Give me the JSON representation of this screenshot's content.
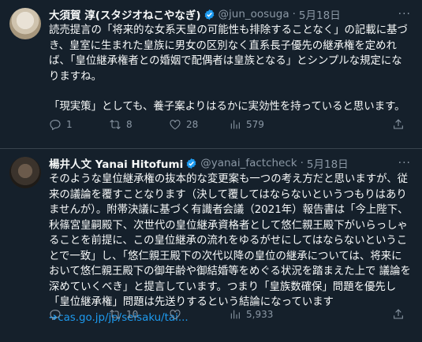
{
  "tweets": [
    {
      "name": "大須賀 淳(スタジオねこやなぎ)",
      "handle": "@jun_oosuga",
      "dot": "·",
      "date": "5月18日",
      "paragraphs": [
        "読売提言の「将来的な女系天皇の可能性も排除することなく」の記載に基づき、皇室に生まれた皇族に男女の区別なく直系長子優先の継承権を定めれば、「皇位継承権者との婚姻で配偶者は皇族となる」とシンプルな規定になりますね。",
        "「現実策」としても、養子案よりはるかに実効性を持っていると思います。"
      ],
      "replies": "1",
      "retweets": "8",
      "likes": "28",
      "views": "579"
    },
    {
      "name": "楊井人文 Yanai Hitofumi",
      "handle": "@yanai_factcheck",
      "dot": "·",
      "date": "5月18日",
      "text": "そのような皇位継承権の抜本的な変更案も一つの考え方だと思いますが、従来の議論を覆すことなります（決して覆してはならないというつもりはありませんが）。附帯決議に基づく有識者会議（2021年）報告書は「今上陛下、秋篠宮皇嗣殿下、次世代の皇位継承資格者として悠仁親王殿下がいらっしゃることを前提に、この皇位継承の流れをゆるがせにしてはならないということで一致」し、「悠仁親王殿下の次代以降の皇位の継承については、将来において悠仁親王殿下の御年齢や御結婚等をめぐる状況を踏まえた上で 議論を深めていくべき」と提言しています。つまり「皇族数確保」問題を優先し「皇位継承権」問題は先送りするという結論になっています",
      "link": "➔cas.go.jp/jp/seisaku/tai...",
      "replies": "",
      "retweets": "10",
      "likes": "",
      "views": "5,933"
    }
  ],
  "icons": [
    "verified-badge-icon",
    "more-icon",
    "reply-icon",
    "retweet-icon",
    "like-icon",
    "views-icon",
    "share-icon"
  ],
  "colors": {
    "background": "#15202b",
    "text": "#f7f9f9",
    "muted": "#8b98a5",
    "accent": "#1d9bf0"
  }
}
